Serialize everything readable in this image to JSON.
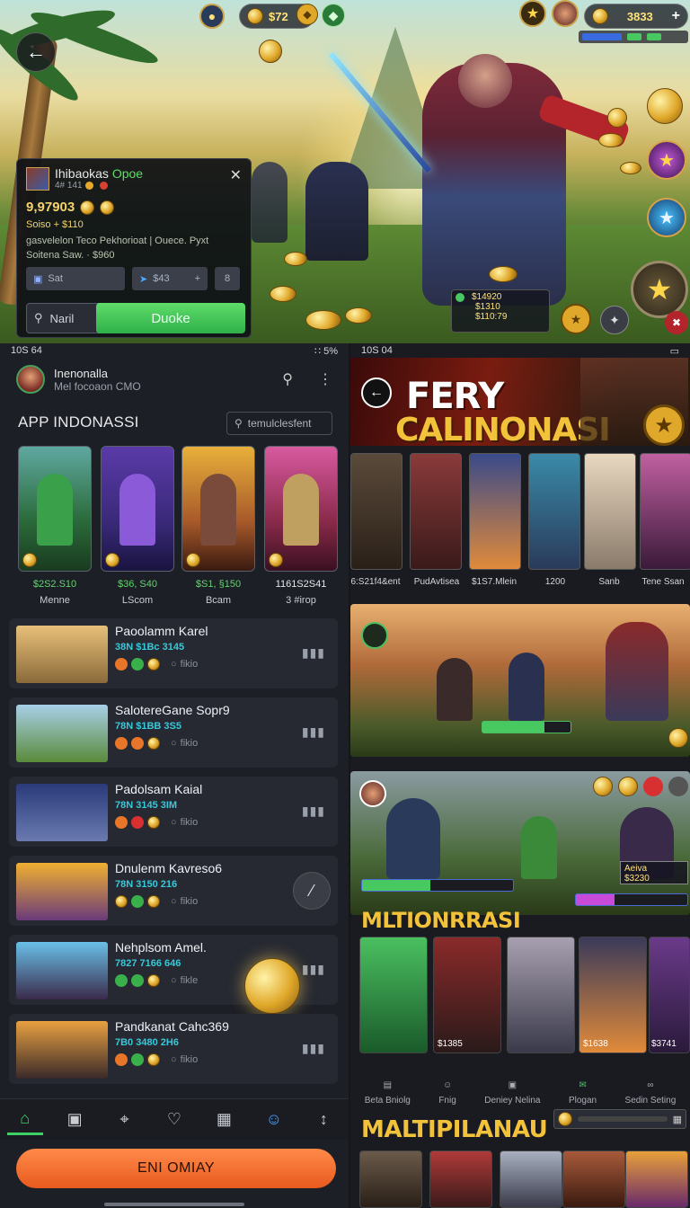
{
  "hero": {
    "topbar_coins": "$72",
    "topbar_gold": "3833",
    "topbar_plus": "+",
    "card": {
      "title": "Ihibaokas",
      "title_accent": "Opoe",
      "meta": "4# 141",
      "price": "9,97903",
      "price_line": "Soiso + $110",
      "desc1": "gasvelelon Teco Pekhorioat | Ouece. Pyxt",
      "desc2": "Soitena Saw. · $960",
      "btn_sort": "Sat",
      "btn_count": "$43",
      "btn_plus": "+",
      "btn_s": "8",
      "search_label": "Naril",
      "cta_label": "Duoke",
      "close": "✕"
    },
    "hud": {
      "line1": "$14920",
      "line2": "$1310",
      "line3": "$110:79"
    }
  },
  "left": {
    "status_time": "10S 64",
    "status_right": "∷ 5%",
    "app_title": "Inenonalla",
    "app_subtitle": "Mel focoaon CMO",
    "section_title": "APP INDONASSI",
    "search_placeholder": "temulclesfent",
    "hero_cards": [
      {
        "value": "$2S2.S10",
        "name": "Menne"
      },
      {
        "value": "$36, S40",
        "name": "LScom"
      },
      {
        "value": "$S1, §150",
        "name": "Bcam"
      },
      {
        "value": "1161S2S41",
        "name": "3 #irop"
      }
    ],
    "rows": [
      {
        "title": "Paoolamm Karel",
        "sub": "38N $1Bc 3145",
        "tail": "fikio"
      },
      {
        "title": "SalotereGane Sopr9",
        "sub": "78N $1BB 3S5",
        "tail": "fikio"
      },
      {
        "title": "Padolsam Kaial",
        "sub": "78N 3145 3IM",
        "tail": "fikio"
      },
      {
        "title": "Dnulenm Kavreso6",
        "sub": "78N 3150 216",
        "tail": "fikio"
      },
      {
        "title": "Nehplsom Amel.",
        "sub": "7827 7166 646",
        "tail": "fikle"
      },
      {
        "title": "Pandkanat Cahc369",
        "sub": "7B0 3480 2H6",
        "tail": "fikio"
      }
    ],
    "cta": "ENI OMIAY"
  },
  "right": {
    "status_time": "10S 04",
    "banner_title1": "FERY",
    "banner_title2": "CALINONASI",
    "strip_labels": [
      "6:S21f4&ent",
      "PudAvtisea",
      "$1S7.Mlein",
      "1200",
      "Sanb",
      "Tene Ssan"
    ],
    "scene2_bar_left": "Aeiva",
    "scene2_bar_right": "$3230",
    "subhead1": "MLTIONRRASI",
    "tile_vals": [
      "$1385",
      "$1638",
      "$3741"
    ],
    "nav": [
      "Beta Bniolg",
      "Fnig",
      "Deniey Nelina",
      "Plogan",
      "Sedin Seting"
    ],
    "subhead2": "MALTIPILANAU"
  },
  "colors": {
    "accent_green": "#2fb04a",
    "accent_orange": "#e85a1d",
    "gold": "#f3c23b",
    "value_green": "#63d46e",
    "value_cyan": "#39c8d8"
  }
}
